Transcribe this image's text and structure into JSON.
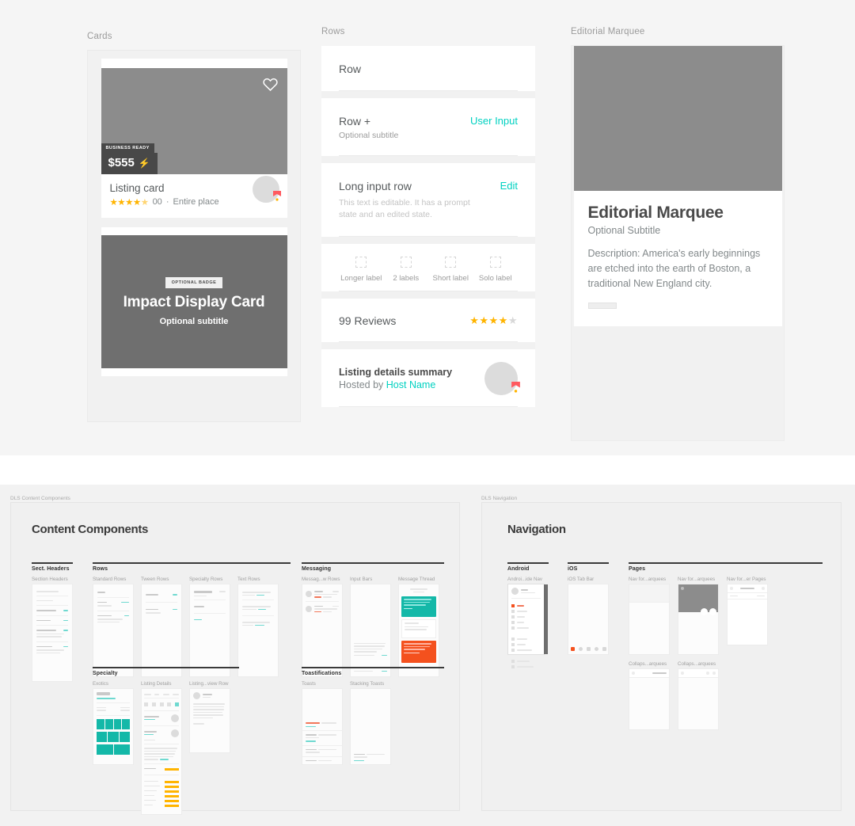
{
  "top": {
    "cards": {
      "section_label": "Cards",
      "listing_card": {
        "badge_business": "BUSINESS READY",
        "price": "$555",
        "bolt_icon": "lightning-bolt-icon",
        "heart_icon": "heart-outline-icon",
        "title": "Listing card",
        "stars": "★★★★",
        "half_star": "★",
        "review_count": "00",
        "separator": "·",
        "place_type": "Entire place",
        "avatar_icon": "user-avatar",
        "superhost_icon": "superhost-badge-icon"
      },
      "impact_card": {
        "badge": "OPTIONAL BADGE",
        "title": "Impact Display Card",
        "subtitle": "Optional subtitle"
      }
    },
    "rows": {
      "section_label": "Rows",
      "items": [
        {
          "title": "Row"
        },
        {
          "title": "Row +",
          "subtitle": "Optional subtitle",
          "action": "User Input"
        },
        {
          "title": "Long input row",
          "action": "Edit",
          "description": "This text is editable. It has a prompt state and an edited state."
        }
      ],
      "checkboxes": [
        {
          "label": "Longer label"
        },
        {
          "label": "2 labels"
        },
        {
          "label": "Short label"
        },
        {
          "label": "Solo label"
        }
      ],
      "reviews": {
        "title": "99 Reviews",
        "stars_filled": "★★★★",
        "star_empty": "★"
      },
      "summary": {
        "title": "Listing details summary",
        "hosted_by": "Hosted by ",
        "host_name": "Host Name"
      }
    },
    "marquee": {
      "section_label": "Editorial Marquee",
      "title": "Editorial Marquee",
      "subtitle": "Optional Subtitle",
      "description": "Description: America's early beginnings are etched into the earth of Boston, a traditional New England city."
    }
  },
  "boards": {
    "content": {
      "frame_label": "DLS Content Components",
      "title": "Content Components",
      "groups": [
        {
          "name": "Sect. Headers",
          "thumbs": [
            {
              "label": "Section Headers"
            }
          ]
        },
        {
          "name": "Rows",
          "thumbs": [
            {
              "label": "Standard Rows"
            },
            {
              "label": "Tween Rows"
            },
            {
              "label": "Specialty Rows"
            },
            {
              "label": "Text Rows"
            }
          ]
        },
        {
          "name": "Messaging",
          "thumbs": [
            {
              "label": "Messag...w Rows"
            },
            {
              "label": "Input Bars"
            },
            {
              "label": "Message Thread"
            }
          ]
        },
        {
          "name": "Specialty",
          "thumbs": [
            {
              "label": "Exotics"
            },
            {
              "label": "Listing Details"
            },
            {
              "label": "Listing...view Row"
            }
          ]
        },
        {
          "name": "Toastifications",
          "thumbs": [
            {
              "label": "Toasts"
            },
            {
              "label": "Stacking Toasts"
            }
          ]
        }
      ]
    },
    "navigation": {
      "frame_label": "DLS Navigation",
      "title": "Navigation",
      "groups": [
        {
          "name": "Android",
          "thumbs": [
            {
              "label": "Androi...ide Nav"
            }
          ]
        },
        {
          "name": "iOS",
          "thumbs": [
            {
              "label": "iOS Tab Bar"
            }
          ]
        },
        {
          "name": "Pages",
          "thumbs": [
            {
              "label": "Nav for...arquees"
            },
            {
              "label": "Nav for...arquees"
            },
            {
              "label": "Nav for...er Pages"
            },
            {
              "label": "Collaps...arquees"
            },
            {
              "label": "Collaps...arquees"
            }
          ]
        }
      ]
    }
  },
  "colors": {
    "accent_teal": "#00d1c1",
    "star_gold": "#ffb400",
    "badge_dark": "#484848",
    "image_gray": "#8c8c8c",
    "page_bg": "#f5f5f5",
    "orange": "#f4511e"
  }
}
